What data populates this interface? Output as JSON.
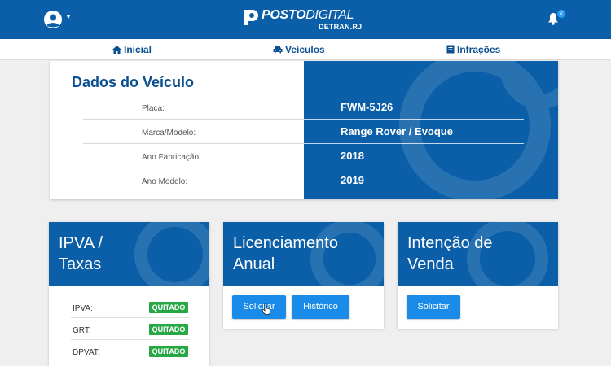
{
  "header": {
    "logo_bold": "POSTO",
    "logo_light": "DIGITAL",
    "logo_sub": "DETRAN.RJ",
    "notification_count": "2",
    "icons": [
      "user-icon",
      "caret-down-icon",
      "bell-icon"
    ]
  },
  "nav": {
    "items": [
      {
        "label": "Inicial",
        "icon": "home-icon"
      },
      {
        "label": "Veículos",
        "icon": "car-icon"
      },
      {
        "label": "Infrações",
        "icon": "document-icon"
      }
    ]
  },
  "vehicle": {
    "title": "Dados do Veículo",
    "rows": [
      {
        "label": "Placa:",
        "value": "FWM-5J26"
      },
      {
        "label": "Marca/Modelo:",
        "value": "Range Rover / Evoque"
      },
      {
        "label": "Ano Fabricação:",
        "value": "2018"
      },
      {
        "label": "Ano Modelo:",
        "value": "2019"
      }
    ]
  },
  "cards": {
    "ipva": {
      "title_line1": "IPVA /",
      "title_line2": "Taxas",
      "items": [
        {
          "label": "IPVA:",
          "status": "QUITADO"
        },
        {
          "label": "GRT:",
          "status": "QUITADO"
        },
        {
          "label": "DPVAT:",
          "status": "QUITADO"
        }
      ]
    },
    "licenciamento": {
      "title_line1": "Licenciamento",
      "title_line2": "Anual",
      "button_request": "Solicitar",
      "button_history": "Histórico"
    },
    "venda": {
      "title_line1": "Intenção de",
      "title_line2": "Venda",
      "button_request": "Solicitar"
    }
  },
  "colors": {
    "primary": "#0b5ea8",
    "button": "#1a8be8",
    "success": "#28a745",
    "background": "#efefef"
  }
}
